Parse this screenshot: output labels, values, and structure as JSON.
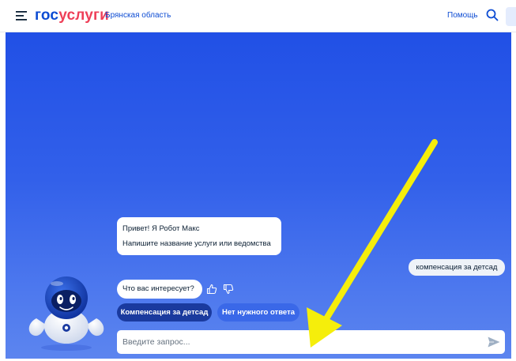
{
  "header": {
    "logo_part1": "гос",
    "logo_part2": "услуги",
    "region": "Брянская область",
    "help_label": "Помощь"
  },
  "chat": {
    "greeting_line1": "Привет! Я Робот Макс",
    "greeting_line2": "Напишите название услуги или ведомства",
    "user_message": "компенсация за детсад",
    "question": "Что вас интересует?",
    "chips": [
      "Компенсация за детсад",
      "Нет нужного ответа"
    ],
    "input_placeholder": "Введите запрос..."
  },
  "colors": {
    "brand_blue": "#0d4cd3",
    "brand_red": "#ee3f58",
    "chat_bg": "#2150e6",
    "annotation_arrow": "#f5ee0b"
  },
  "icons": [
    "menu-icon",
    "search-icon",
    "thumbs-up-icon",
    "thumbs-down-icon",
    "send-icon",
    "robot-avatar"
  ]
}
